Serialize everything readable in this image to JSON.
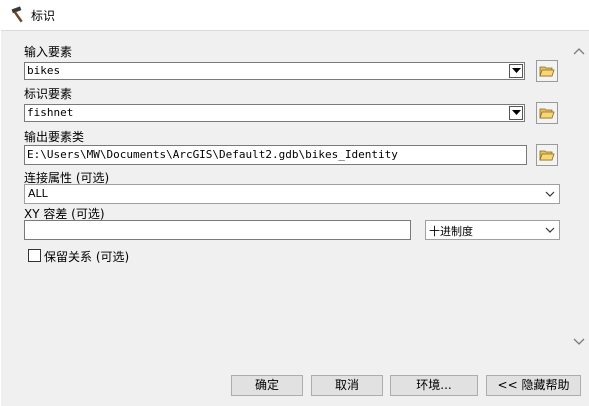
{
  "window": {
    "title": "标识",
    "icon": "hammer-icon"
  },
  "form": {
    "input_features": {
      "label": "输入要素",
      "value": "bikes"
    },
    "identity_features": {
      "label": "标识要素",
      "value": "fishnet"
    },
    "output_feature_class": {
      "label": "输出要素类",
      "value": "E:\\Users\\MW\\Documents\\ArcGIS\\Default2.gdb\\bikes_Identity"
    },
    "join_attributes": {
      "label": "连接属性 (可选)",
      "value": "ALL"
    },
    "xy_tolerance": {
      "label": "XY 容差 (可选)",
      "value": "",
      "unit": "十进制度"
    },
    "keep_relationships": {
      "label": "保留关系 (可选)",
      "checked": false
    }
  },
  "buttons": {
    "ok": "确定",
    "cancel": "取消",
    "environments": "环境...",
    "hide_help": "<< 隐藏帮助"
  }
}
